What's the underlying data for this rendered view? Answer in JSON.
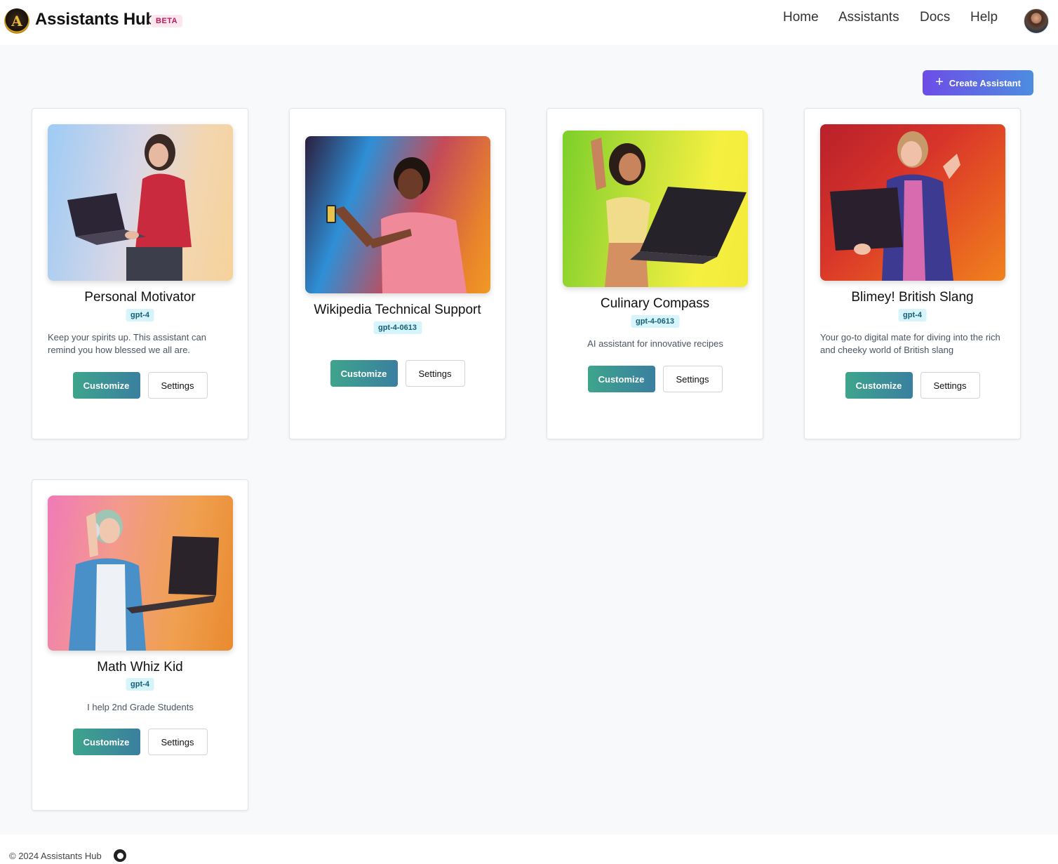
{
  "header": {
    "brand": "Assistants Hub",
    "badge": "BETA",
    "nav": [
      "Home",
      "Assistants",
      "Docs",
      "Help"
    ]
  },
  "toolbar": {
    "create_label": "Create Assistant",
    "create_icon": "plus-icon"
  },
  "cards": [
    {
      "title": "Personal Motivator",
      "model": "gpt-4",
      "description": "Keep your spirits up. This assistant can remind you how blessed we all are.",
      "customize_label": "Customize",
      "settings_label": "Settings"
    },
    {
      "title": "Wikipedia Technical Support",
      "model": "gpt-4-0613",
      "description": "",
      "customize_label": "Customize",
      "settings_label": "Settings"
    },
    {
      "title": "Culinary Compass",
      "model": "gpt-4-0613",
      "description": "AI assistant for innovative recipes",
      "customize_label": "Customize",
      "settings_label": "Settings"
    },
    {
      "title": "Blimey! British Slang",
      "model": "gpt-4",
      "description": "Your go-to digital mate for diving into the rich and cheeky world of British slang",
      "customize_label": "Customize",
      "settings_label": "Settings"
    },
    {
      "title": "Math Whiz Kid",
      "model": "gpt-4",
      "description": "I help 2nd Grade Students",
      "customize_label": "Customize",
      "settings_label": "Settings"
    }
  ],
  "footer": {
    "copyright": "© 2024 Assistants Hub",
    "github_icon": "github-icon"
  },
  "colors": {
    "accent_purple": "#6d4de6",
    "accent_blue": "#4d8de0",
    "customize_green": "#3ea48c",
    "beta_pink": "#be185d",
    "model_badge_bg": "#d6f4fb"
  }
}
